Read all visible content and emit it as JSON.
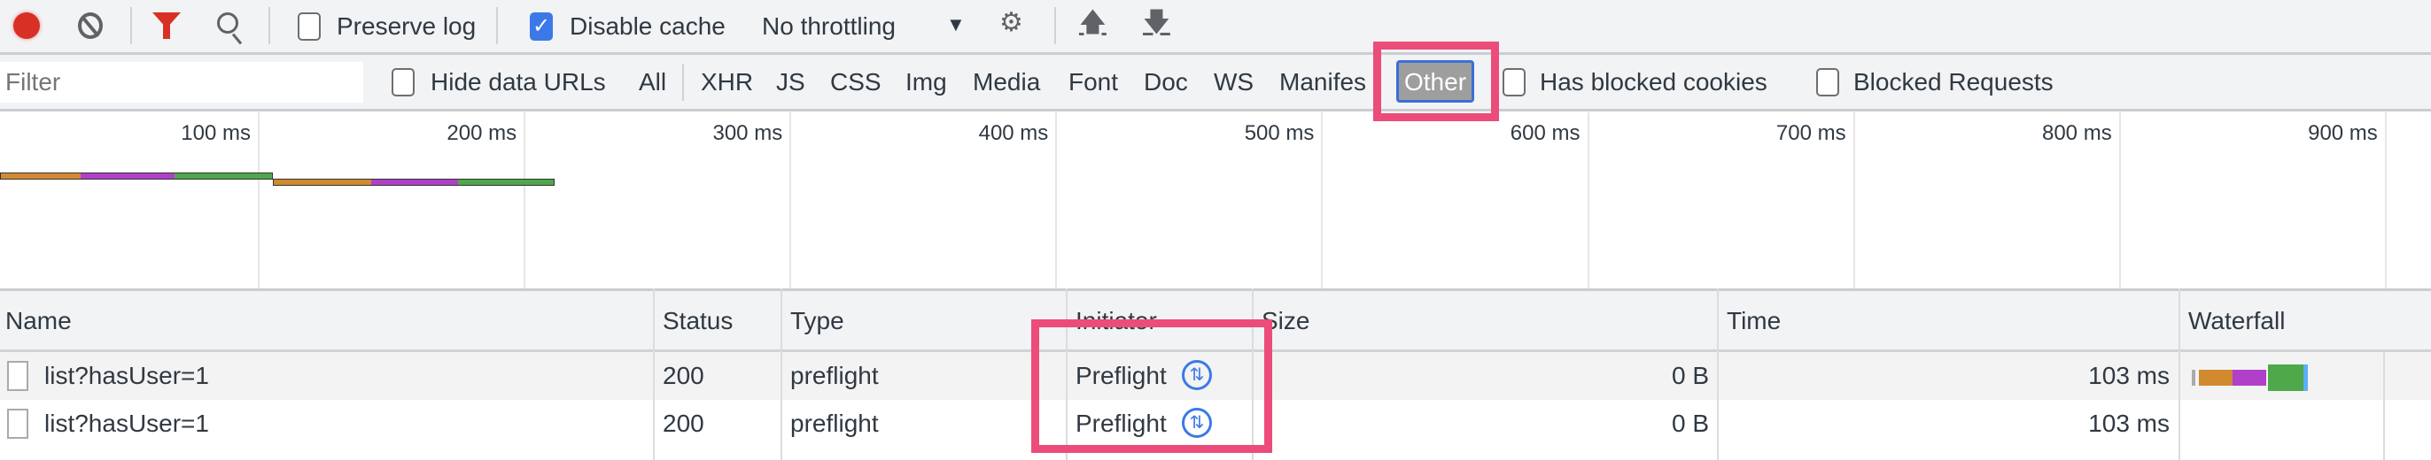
{
  "toolbar": {
    "record_icon": "record-icon",
    "clear_icon": "clear-icon",
    "filter_icon": "filter-icon",
    "search_icon": "search-icon",
    "preserve_log": "Preserve log",
    "preserve_log_checked": false,
    "disable_cache": "Disable cache",
    "disable_cache_checked": true,
    "throttling": "No throttling",
    "network_conditions_icon": "wifi-gear-icon",
    "import_icon": "upload-icon",
    "export_icon": "download-icon"
  },
  "filterbar": {
    "placeholder": "Filter",
    "hide_data_urls": "Hide data URLs",
    "types": [
      "All",
      "XHR",
      "JS",
      "CSS",
      "Img",
      "Media",
      "Font",
      "Doc",
      "WS",
      "Manifes",
      "Other"
    ],
    "active_type": "Other",
    "has_blocked_cookies": "Has blocked cookies",
    "blocked_requests": "Blocked Requests"
  },
  "overview": {
    "ticks": [
      "100 ms",
      "200 ms",
      "300 ms",
      "400 ms",
      "500 ms",
      "600 ms",
      "700 ms",
      "800 ms",
      "900 ms"
    ]
  },
  "table": {
    "headers": [
      "Name",
      "Status",
      "Type",
      "Initiator",
      "Size",
      "Time",
      "Waterfall"
    ],
    "rows": [
      {
        "name": "list?hasUser=1",
        "status": "200",
        "type": "preflight",
        "initiator": "Preflight",
        "size": "0 B",
        "time": "103 ms"
      },
      {
        "name": "list?hasUser=1",
        "status": "200",
        "type": "preflight",
        "initiator": "Preflight",
        "size": "0 B",
        "time": "103 ms"
      }
    ]
  },
  "colors": {
    "highlight": "#ec4c7a",
    "accent": "#3b79e8",
    "record": "#d93025",
    "waterfall_queue": "#d18a30",
    "waterfall_ssl": "#b140c9",
    "waterfall_wait": "#4fa84a",
    "waterfall_download": "#5bb0f5"
  }
}
